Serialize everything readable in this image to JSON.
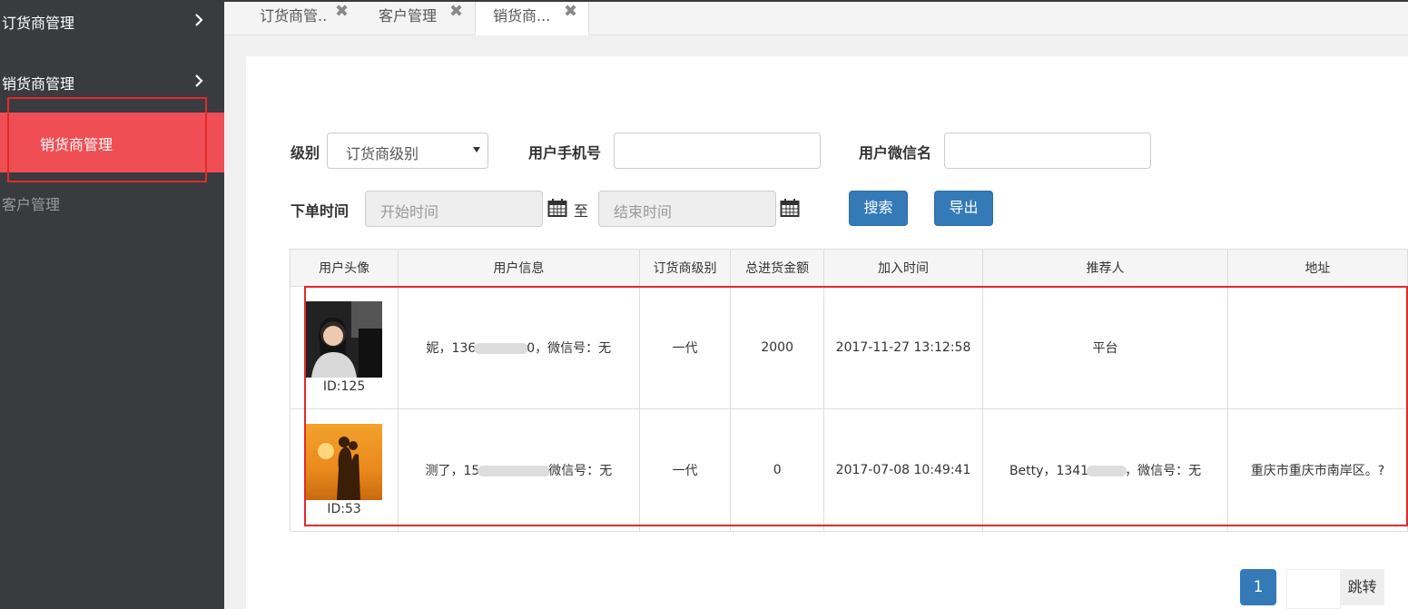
{
  "sidebar": {
    "items": [
      {
        "label": "订货商管理"
      },
      {
        "label": "销货商管理"
      }
    ],
    "sub_item": "销货商管理",
    "plain_item": "客户管理"
  },
  "tabs": [
    {
      "label": "订货商管..",
      "close": "✖"
    },
    {
      "label": "客户管理",
      "close": "✖"
    },
    {
      "label": "销货商...",
      "close": "✖"
    }
  ],
  "filters": {
    "level_label": "级别",
    "level_value": "订货商级别",
    "phone_label": "用户手机号",
    "wechat_label": "用户微信名",
    "time_label": "下单时间",
    "start_placeholder": "开始时间",
    "to_label": "至",
    "end_placeholder": "结束时间",
    "search_button": "搜索",
    "export_button": "导出"
  },
  "table": {
    "headers": [
      "用户头像",
      "用户信息",
      "订货商级别",
      "总进货金额",
      "加入时间",
      "推荐人",
      "地址"
    ],
    "rows": [
      {
        "id": "ID:125",
        "info_a": "妮，136",
        "info_b": "0，微信号：无",
        "level": "一代",
        "amount": "2000",
        "joined": "2017-11-27 13:12:58",
        "referrer_a": "平台",
        "referrer_b": "",
        "address": ""
      },
      {
        "id": "ID:53",
        "info_a": "测了，15",
        "info_b": "微信号：无",
        "level": "一代",
        "amount": "0",
        "joined": "2017-07-08 10:49:41",
        "referrer_a": "Betty，1341",
        "referrer_b": "，微信号：无",
        "address": "重庆市重庆市南岸区。?"
      }
    ]
  },
  "pagination": {
    "current": "1",
    "go_label": "跳转"
  },
  "colors": {
    "sidebar_bg": "#3a3b3f",
    "active_red": "#ef4f54",
    "primary_blue": "#337ab7",
    "highlight_red": "#e02b2b"
  }
}
